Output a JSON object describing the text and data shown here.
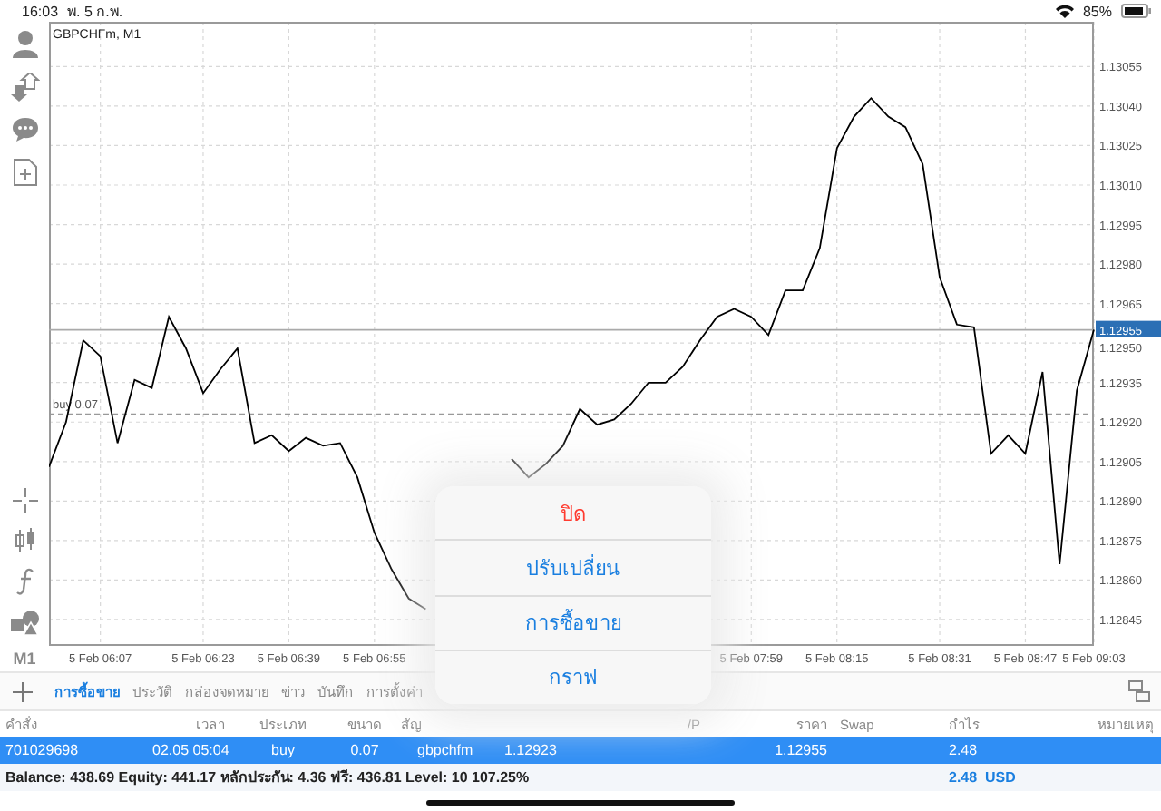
{
  "status_bar": {
    "time": "16:03",
    "date": "พ. 5 ก.พ.",
    "battery": "85%"
  },
  "side_toolbar": {
    "timeframe": "M1"
  },
  "chart": {
    "title": "GBPCHFm, M1",
    "chart_data": {
      "type": "line",
      "grid": true,
      "ylim": [
        1.12835,
        1.13072
      ],
      "ref_lines": [
        {
          "axis": "y",
          "value": 1.12923,
          "label": "buy 0.07"
        },
        {
          "axis": "y",
          "value": 1.12955,
          "label": "1.12955"
        }
      ],
      "categories": [
        null,
        null,
        null,
        "5 Feb 06:07",
        null,
        null,
        null,
        null,
        null,
        "5 Feb 06:23",
        null,
        null,
        null,
        null,
        "5 Feb 06:39",
        null,
        null,
        null,
        null,
        "5 Feb 06:55",
        null,
        null,
        null,
        null,
        null,
        null,
        null,
        null,
        null,
        null,
        null,
        null,
        null,
        null,
        null,
        null,
        null,
        null,
        null,
        null,
        null,
        "5 Feb 07:59",
        null,
        null,
        null,
        null,
        "5 Feb 08:15",
        null,
        null,
        null,
        null,
        null,
        "5 Feb 08:31",
        null,
        null,
        null,
        null,
        "5 Feb 08:47",
        null,
        null,
        null,
        "5 Feb 09:03"
      ],
      "series": [
        {
          "color": "#000000",
          "values": [
            1.12903,
            1.1292,
            1.12951,
            1.12945,
            1.12912,
            1.12936,
            1.12933,
            1.1296,
            1.12948,
            1.12931,
            1.1294,
            1.12948,
            1.12912,
            1.12915,
            1.12909,
            1.12914,
            1.12911,
            1.12912,
            1.12899,
            1.12878,
            1.12864,
            1.12853,
            1.12849,
            null,
            null,
            null,
            null,
            1.12906,
            1.12899,
            1.12904,
            1.12911,
            1.12925,
            1.12919,
            1.12921,
            1.12927,
            1.12935,
            1.12935,
            1.12941,
            1.12951,
            1.1296,
            1.12963,
            1.1296,
            1.12953,
            1.1297,
            1.1297,
            1.12986,
            1.13024,
            1.13036,
            1.13043,
            1.13036,
            1.13032,
            1.13018,
            1.12975,
            1.12957,
            1.12956,
            1.12908,
            1.12915,
            1.12908,
            1.12939,
            1.12866,
            1.12932,
            1.12955
          ]
        }
      ],
      "yticks": [
        {
          "value": 1.12845,
          "label": "1.12845"
        },
        {
          "value": 1.1286,
          "label": "1.12860"
        },
        {
          "value": 1.12875,
          "label": "1.12875"
        },
        {
          "value": 1.1289,
          "label": "1.12890"
        },
        {
          "value": 1.12905,
          "label": "1.12905"
        },
        {
          "value": 1.1292,
          "label": "1.12920"
        },
        {
          "value": 1.12935,
          "label": "1.12935"
        },
        {
          "value": 1.1295,
          "label": "1.12950"
        },
        {
          "value": 1.12965,
          "label": "1.12965"
        },
        {
          "value": 1.1298,
          "label": "1.12980"
        },
        {
          "value": 1.12995,
          "label": "1.12995"
        },
        {
          "value": 1.1301,
          "label": "1.13010"
        },
        {
          "value": 1.13025,
          "label": "1.13025"
        },
        {
          "value": 1.1304,
          "label": "1.13040"
        },
        {
          "value": 1.13055,
          "label": "1.13055"
        }
      ]
    }
  },
  "tabs": [
    {
      "label": "การซื้อขาย",
      "selected": true
    },
    {
      "label": "ประวัติ",
      "selected": false
    },
    {
      "label": "กล่องจดหมาย",
      "selected": false
    },
    {
      "label": "ข่าว",
      "selected": false
    },
    {
      "label": "บันทึก",
      "selected": false
    },
    {
      "label": "การตั้งค่า",
      "selected": false
    }
  ],
  "table": {
    "columns": [
      "คำสั่ง",
      "เวลา",
      "ประเภท",
      "ขนาด",
      "สัญ",
      "/P",
      "ราคา",
      "Swap",
      "กำไร",
      "หมายเหตุ"
    ],
    "rows": [
      {
        "order": "701029698",
        "time": "02.05 05:04",
        "type": "buy",
        "volume": "0.07",
        "symbol": "gbpchfm",
        "open_price": "1.12923",
        "price": "1.12955",
        "profit": "2.48",
        "selected": true
      }
    ]
  },
  "summary": {
    "text": "Balance: 438.69 Equity: 441.17 หลักประกัน: 4.36 ฟรี: 436.81 Level: 10 107.25%",
    "profit": "2.48",
    "currency": "USD"
  },
  "action_sheet": {
    "items": [
      {
        "label": "ปิด",
        "kind": "destructive"
      },
      {
        "label": "ปรับเปลี่ยน",
        "kind": "default"
      },
      {
        "label": "การซื้อขาย",
        "kind": "default"
      },
      {
        "label": "กราฟ",
        "kind": "default"
      }
    ]
  }
}
